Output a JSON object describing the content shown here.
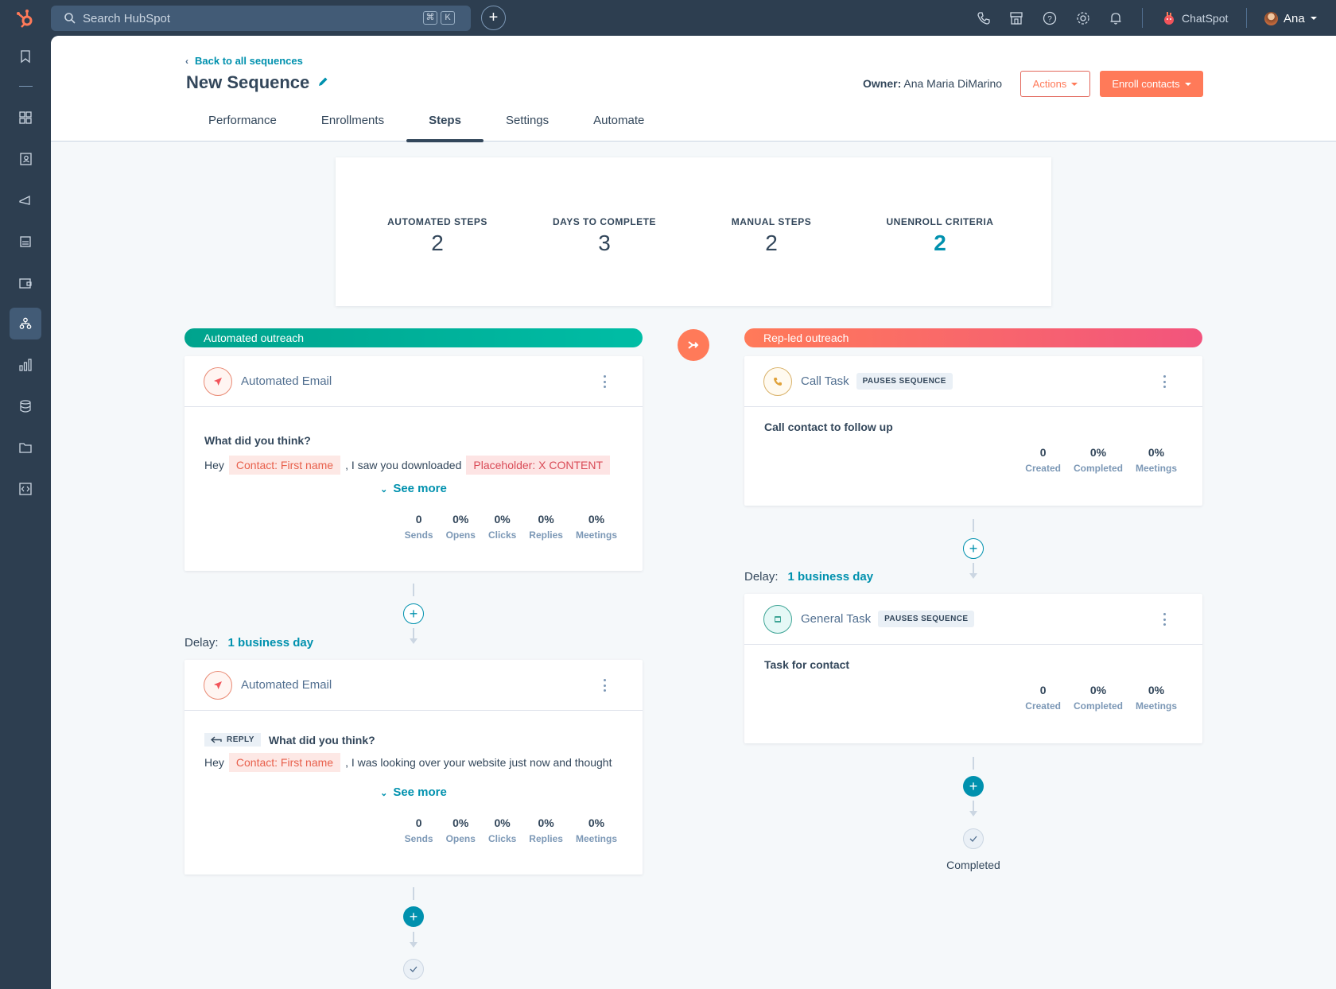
{
  "topbar": {
    "search_placeholder": "Search HubSpot",
    "shortcut_keys": [
      "⌘",
      "K"
    ],
    "create_label": "+",
    "icons": [
      "phone-icon",
      "marketplace-icon",
      "help-icon",
      "settings-icon",
      "notifications-icon"
    ],
    "chatspot_label": "ChatSpot",
    "user_name": "Ana"
  },
  "sidebar": {
    "items": [
      {
        "icon": "bookmark-icon",
        "active": false
      },
      {
        "icon": "dashboard-grid-icon",
        "active": false
      },
      {
        "icon": "contacts-icon",
        "active": false
      },
      {
        "icon": "marketing-megaphone-icon",
        "active": false
      },
      {
        "icon": "content-icon",
        "active": false
      },
      {
        "icon": "commerce-wallet-icon",
        "active": false
      },
      {
        "icon": "automation-icon",
        "active": true
      },
      {
        "icon": "reports-icon",
        "active": false
      },
      {
        "icon": "data-database-icon",
        "active": false
      },
      {
        "icon": "library-folder-icon",
        "active": false
      },
      {
        "icon": "developer-code-icon",
        "active": false
      }
    ]
  },
  "header": {
    "back_link": "Back to all sequences",
    "title": "New Sequence",
    "owner_label": "Owner:",
    "owner_name": "Ana Maria DiMarino",
    "actions_label": "Actions",
    "enroll_label": "Enroll contacts",
    "tabs": [
      {
        "label": "Performance",
        "active": false
      },
      {
        "label": "Enrollments",
        "active": false
      },
      {
        "label": "Steps",
        "active": true
      },
      {
        "label": "Settings",
        "active": false
      },
      {
        "label": "Automate",
        "active": false
      }
    ]
  },
  "summary": [
    {
      "label": "AUTOMATED STEPS",
      "value": "2"
    },
    {
      "label": "DAYS TO COMPLETE",
      "value": "3"
    },
    {
      "label": "MANUAL STEPS",
      "value": "2"
    },
    {
      "label": "UNENROLL CRITERIA",
      "value": "2"
    }
  ],
  "colors": {
    "accent_teal": "#0091ae",
    "automated_banner": "#00bda5",
    "rep_banner_start": "#ff7a59",
    "rep_banner_end": "#f2547d",
    "primary_orange": "#ff7a59"
  },
  "automated": {
    "banner": "Automated outreach",
    "steps": [
      {
        "type": "Automated Email",
        "subject": "What did you think?",
        "greeting": "Hey",
        "token": "Contact: First name",
        "body": ", I saw you downloaded",
        "placeholder": "Placeholder: X CONTENT",
        "see_more": "See more",
        "metrics": [
          {
            "value": "0",
            "label": "Sends"
          },
          {
            "value": "0%",
            "label": "Opens"
          },
          {
            "value": "0%",
            "label": "Clicks"
          },
          {
            "value": "0%",
            "label": "Replies"
          },
          {
            "value": "0%",
            "label": "Meetings"
          }
        ]
      },
      {
        "type": "Automated Email",
        "reply_tag": "REPLY",
        "subject": "What did you think?",
        "greeting": "Hey",
        "token": "Contact: First name",
        "body": ", I was looking over your website just now and thought",
        "see_more": "See more",
        "metrics": [
          {
            "value": "0",
            "label": "Sends"
          },
          {
            "value": "0%",
            "label": "Opens"
          },
          {
            "value": "0%",
            "label": "Clicks"
          },
          {
            "value": "0%",
            "label": "Replies"
          },
          {
            "value": "0%",
            "label": "Meetings"
          }
        ]
      }
    ],
    "delay_label": "Delay:",
    "delay_value": "1 business day"
  },
  "rep": {
    "banner": "Rep-led outreach",
    "steps": [
      {
        "type": "Call Task",
        "badge": "PAUSES SEQUENCE",
        "title": "Call contact to follow up",
        "metrics": [
          {
            "value": "0",
            "label": "Created"
          },
          {
            "value": "0%",
            "label": "Completed"
          },
          {
            "value": "0%",
            "label": "Meetings"
          }
        ]
      },
      {
        "type": "General Task",
        "badge": "PAUSES SEQUENCE",
        "title": "Task for contact",
        "metrics": [
          {
            "value": "0",
            "label": "Created"
          },
          {
            "value": "0%",
            "label": "Completed"
          },
          {
            "value": "0%",
            "label": "Meetings"
          }
        ]
      }
    ],
    "delay_label": "Delay:",
    "delay_value": "1 business day",
    "completed_label": "Completed"
  }
}
